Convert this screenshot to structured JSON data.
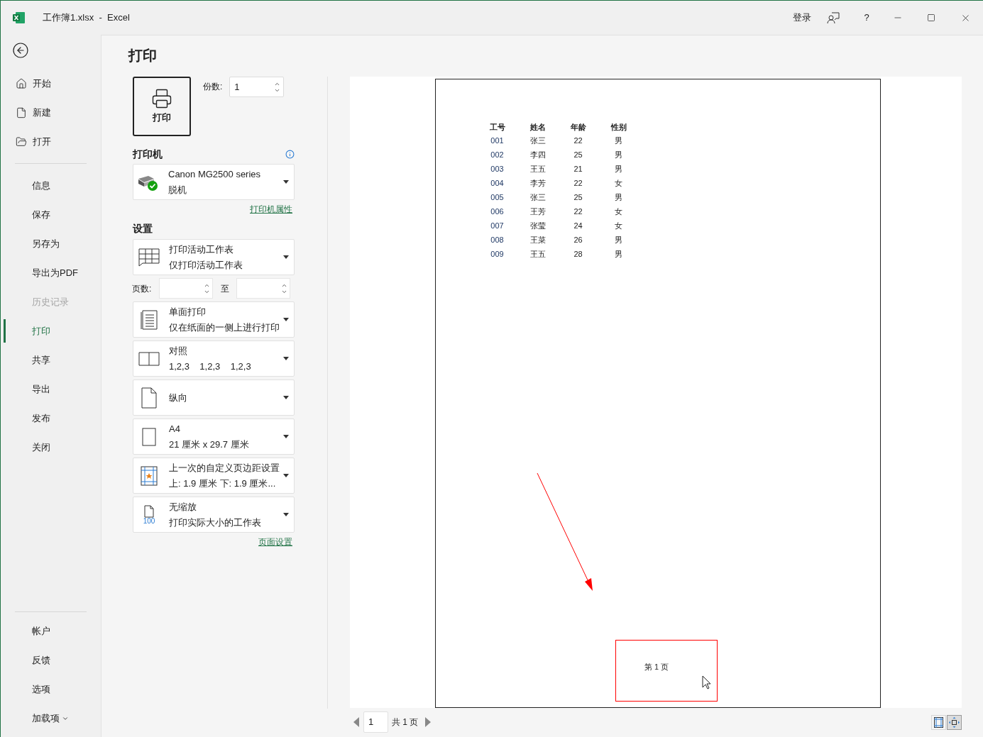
{
  "window": {
    "title": "工作簿1.xlsx  -  Excel",
    "sign_in": "登录",
    "help": "?"
  },
  "sidebar": {
    "top": [
      {
        "kind": "home",
        "label": "开始"
      },
      {
        "kind": "new",
        "label": "新建"
      },
      {
        "kind": "open",
        "label": "打开"
      }
    ],
    "items": [
      {
        "label": "信息",
        "selected": false,
        "disabled": false
      },
      {
        "label": "保存",
        "selected": false,
        "disabled": false
      },
      {
        "label": "另存为",
        "selected": false,
        "disabled": false
      },
      {
        "label": "导出为PDF",
        "selected": false,
        "disabled": false
      },
      {
        "label": "历史记录",
        "selected": false,
        "disabled": true
      },
      {
        "label": "打印",
        "selected": true,
        "disabled": false
      },
      {
        "label": "共享",
        "selected": false,
        "disabled": false
      },
      {
        "label": "导出",
        "selected": false,
        "disabled": false
      },
      {
        "label": "发布",
        "selected": false,
        "disabled": false
      },
      {
        "label": "关闭",
        "selected": false,
        "disabled": false
      }
    ],
    "bottom": [
      {
        "label": "帐户",
        "has_menu": false
      },
      {
        "label": "反馈",
        "has_menu": false
      },
      {
        "label": "选项",
        "has_menu": false
      },
      {
        "label": "加载项",
        "has_menu": true
      }
    ]
  },
  "print": {
    "heading": "打印",
    "print_button": "打印",
    "copies_label": "份数:",
    "copies_value": "1",
    "printer": {
      "heading": "打印机",
      "name": "Canon MG2500 series",
      "status": "脱机",
      "link": "打印机属性"
    },
    "settings_heading": "设置",
    "pages": {
      "label": "页数:",
      "to": "至"
    },
    "settings": [
      {
        "kind": "sheets",
        "title": "打印活动工作表",
        "subtitle": "仅打印活动工作表"
      },
      {
        "kind": "duplex",
        "title": "单面打印",
        "subtitle": "仅在纸面的一侧上进行打印"
      },
      {
        "kind": "collate",
        "title": "对照",
        "subtitle": "1,2,3    1,2,3    1,2,3"
      },
      {
        "kind": "orientation",
        "title": "纵向"
      },
      {
        "kind": "paper",
        "title": "A4",
        "subtitle": "21 厘米 x 29.7 厘米"
      },
      {
        "kind": "margins",
        "title": "上一次的自定义页边距设置",
        "subtitle": "上: 1.9 厘米 下: 1.9 厘米..."
      },
      {
        "kind": "scaling",
        "title": "无缩放",
        "subtitle": "打印实际大小的工作表",
        "icon_text": "100"
      }
    ],
    "page_setup_link": "页面设置"
  },
  "preview": {
    "table": {
      "columns": [
        "工号",
        "姓名",
        "年龄",
        "性别"
      ],
      "rows": [
        [
          "001",
          "张三",
          "22",
          "男"
        ],
        [
          "002",
          "李四",
          "25",
          "男"
        ],
        [
          "003",
          "王五",
          "21",
          "男"
        ],
        [
          "004",
          "李芳",
          "22",
          "女"
        ],
        [
          "005",
          "张三",
          "25",
          "男"
        ],
        [
          "006",
          "王芳",
          "22",
          "女"
        ],
        [
          "007",
          "张莹",
          "24",
          "女"
        ],
        [
          "008",
          "王菜",
          "26",
          "男"
        ],
        [
          "009",
          "王五",
          "28",
          "男"
        ]
      ]
    },
    "footer": "第 1 页",
    "page_number": "1",
    "page_total": "共 1 页",
    "view_buttons": [
      {
        "kind": "margins",
        "selected": false
      },
      {
        "kind": "zoom",
        "selected": true
      }
    ]
  }
}
